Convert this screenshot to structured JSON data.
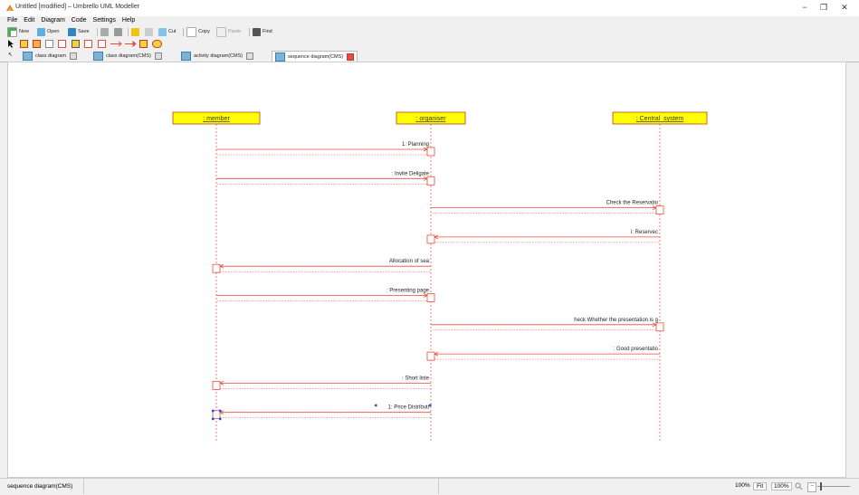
{
  "window": {
    "title": "Untitled [modified] – Umbrello UML Modeller",
    "minimize": "−",
    "maximize": "❐",
    "close": "✕"
  },
  "menu": [
    "File",
    "Edit",
    "Diagram",
    "Code",
    "Settings",
    "Help"
  ],
  "toolbar": {
    "new": "New",
    "open": "Open",
    "save": "Save",
    "cut": "Cut",
    "copy": "Copy",
    "paste": "Paste",
    "find": "Find"
  },
  "tabs": [
    {
      "label": "class diagram",
      "active": false
    },
    {
      "label": "class diagram(CMS)",
      "active": false
    },
    {
      "label": "activity diagram(CMS)",
      "active": false
    },
    {
      "label": "sequence diagram(CMS)",
      "active": true
    }
  ],
  "diagram": {
    "objects": [
      {
        "id": "member",
        "label": ": member"
      },
      {
        "id": "organiser",
        "label": ": organiser"
      },
      {
        "id": "central",
        "label": ": Central_system"
      }
    ],
    "messages": [
      {
        "label": "1: Planning",
        "from": "member",
        "to": "organiser"
      },
      {
        "label": ": Invite Deligate",
        "from": "member",
        "to": "organiser"
      },
      {
        "label": "Check the Reservatio",
        "from": "organiser",
        "to": "central"
      },
      {
        "label": "i: Reservec",
        "from": "central",
        "to": "organiser"
      },
      {
        "label": "Allocation of sea",
        "from": "organiser",
        "to": "member"
      },
      {
        "label": ": Presenting page",
        "from": "member",
        "to": "organiser"
      },
      {
        "label": "heck Whether the presentation is g",
        "from": "organiser",
        "to": "central"
      },
      {
        "label": ": Good presentatio",
        "from": "central",
        "to": "organiser"
      },
      {
        "label": ": Short liste",
        "from": "organiser",
        "to": "member"
      },
      {
        "label": "1: Price Distributi",
        "from": "organiser",
        "to": "member",
        "selected": true
      }
    ]
  },
  "status": {
    "text": "sequence diagram(CMS)",
    "zoom_percent": "100%",
    "fit": "Fit",
    "zoom_button": "100%",
    "zoom_icon": "magnifier-icon"
  },
  "colors": {
    "object_fill": "#ffff00",
    "object_border": "#c0392b",
    "message": "#e74c3c"
  }
}
